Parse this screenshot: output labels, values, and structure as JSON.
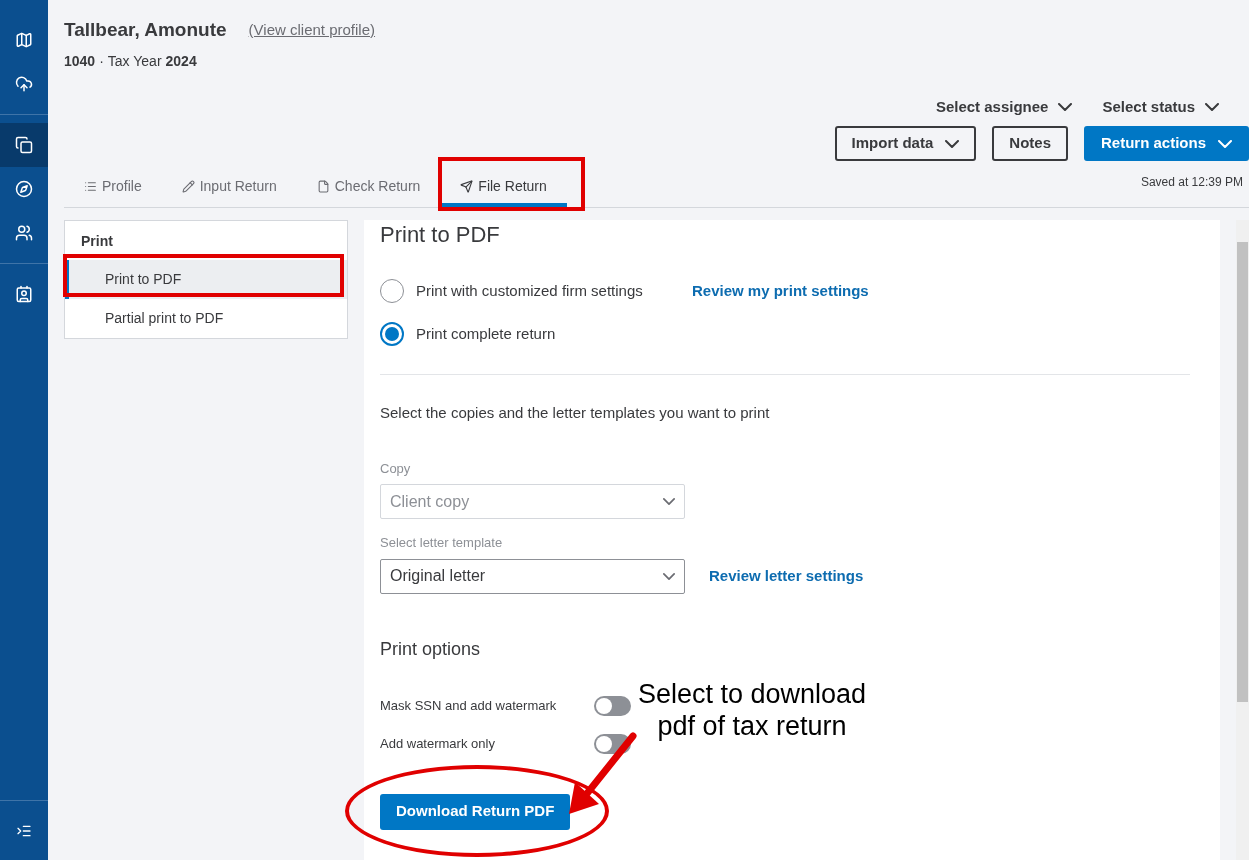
{
  "sidebar": {
    "items": [
      {
        "selected": false
      },
      {
        "selected": false
      },
      {
        "selected": true
      },
      {
        "selected": false
      },
      {
        "selected": false
      },
      {
        "selected": false
      }
    ]
  },
  "header": {
    "client_name": "Tallbear, Amonute",
    "profile_link": "(View client profile)",
    "form": "1040",
    "separator": "·",
    "year_label": "Tax Year",
    "year": "2024"
  },
  "selects": [
    {
      "label": "Select assignee"
    },
    {
      "label": "Select status"
    }
  ],
  "actions": [
    {
      "label": "Import data",
      "kind": "dropdown"
    },
    {
      "label": "Notes",
      "kind": "plain"
    },
    {
      "label": "Return actions",
      "kind": "primary"
    }
  ],
  "tabs": [
    {
      "label": "Profile",
      "selected": false
    },
    {
      "label": "Input Return",
      "selected": false
    },
    {
      "label": "Check Return",
      "selected": false
    },
    {
      "label": "File Return",
      "selected": true
    }
  ],
  "saved": "Saved at 12:39 PM",
  "nav": {
    "heading": "Print",
    "items": [
      {
        "label": "Print to PDF",
        "selected": true
      },
      {
        "label": "Partial print to PDF",
        "selected": false
      }
    ]
  },
  "panel": {
    "title": "Print to PDF",
    "radios": [
      {
        "label": "Print with customized firm settings",
        "selected": false,
        "link": "Review my print settings"
      },
      {
        "label": "Print complete return",
        "selected": true
      }
    ],
    "instruction": "Select the copies and the letter templates you want to print",
    "fields": [
      {
        "label": "Copy",
        "value": "Client copy",
        "disabled": true
      },
      {
        "label": "Select letter template",
        "value": "Original letter",
        "disabled": false,
        "link": "Review letter settings"
      }
    ],
    "options_title": "Print options",
    "toggles": [
      {
        "label": "Mask SSN and add watermark",
        "on": false
      },
      {
        "label": "Add watermark only",
        "on": false
      }
    ],
    "download": "Download Return PDF"
  },
  "annotation": {
    "callout": "Select to download pdf of tax return"
  }
}
